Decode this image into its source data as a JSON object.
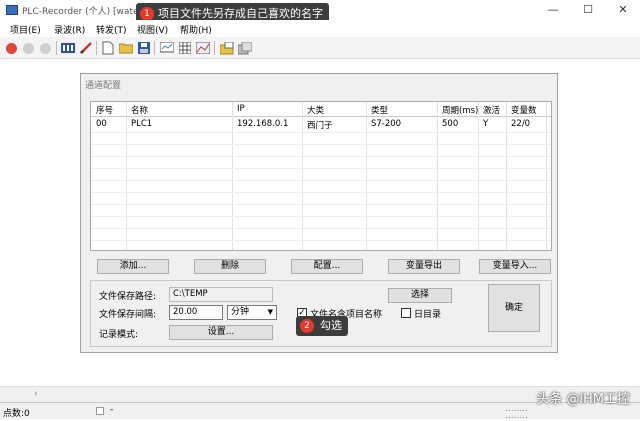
{
  "window": {
    "title": "PLC-Recorder (个人) [water1]",
    "min_glyph": "—",
    "max_glyph": "☐",
    "close_glyph": "✕"
  },
  "menu": [
    "项目(E)",
    "录波(R)",
    "转发(T)",
    "视图(V)",
    "帮助(H)"
  ],
  "toolbar": {
    "icons": [
      "record-icon",
      "pause-icon",
      "stop-icon",
      "module-icon",
      "edit-icon",
      "new-file-icon",
      "open-folder-icon",
      "save-icon",
      "monitor-icon",
      "grid-icon",
      "chart-icon",
      "export-icon",
      "import-icon"
    ]
  },
  "dialog": {
    "title": "通道配置",
    "columns": [
      "序号",
      "名称",
      "IP",
      "大类",
      "类型",
      "周期(ms)",
      "激活",
      "变量数"
    ],
    "rows": [
      [
        "00",
        "PLC1",
        "192.168.0.1",
        "西门子",
        "S7-200",
        "500",
        "Y",
        "22/0"
      ]
    ],
    "buttons": {
      "add": "添加...",
      "delete": "删除",
      "config": "配置...",
      "export_vars": "变量导出",
      "import_vars": "变量导入..."
    },
    "save_path_label": "文件保存路径:",
    "save_path_value": "C:\\TEMP",
    "browse_button": "选择",
    "interval_label": "文件保存间隔:",
    "interval_value": "20.00",
    "interval_unit": "分钟",
    "filename_checkbox_label": "文件名含项目名称",
    "filename_checked": true,
    "date_dir_label": "日目录",
    "date_dir_checked": false,
    "record_mode_label": "记录模式:",
    "settings_button": "设置...",
    "ok_button": "确定"
  },
  "annotations": [
    {
      "badge": "1",
      "text": "项目文件先另存成自己喜欢的名字"
    },
    {
      "badge": "2",
      "text": "勾选"
    }
  ],
  "statusbar": {
    "points": "点数:0",
    "status_dash": "-",
    "right_dots": "........",
    "right_dots2": "........"
  },
  "watermark": "头条 @iHM工控"
}
